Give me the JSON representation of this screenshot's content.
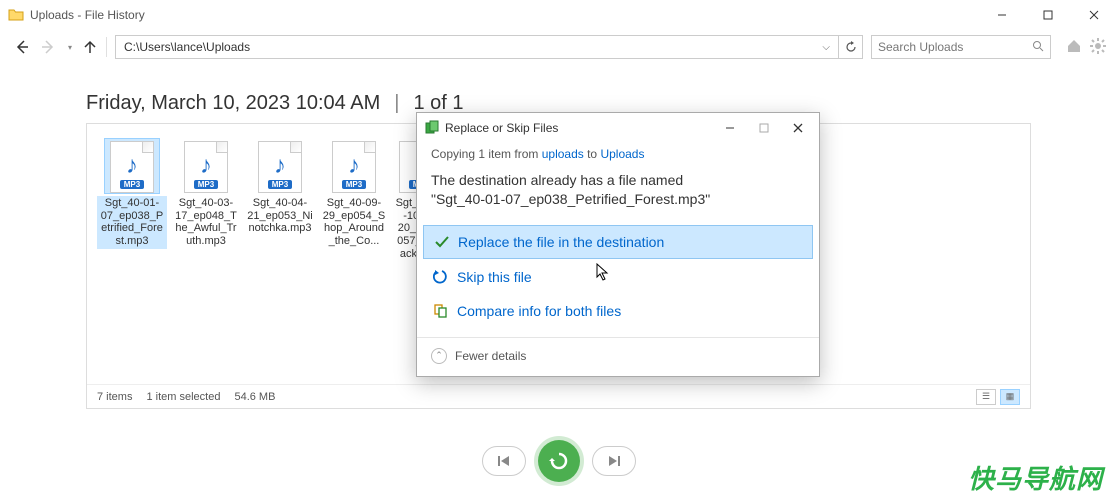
{
  "window": {
    "title": "Uploads - File History"
  },
  "nav": {
    "address_path": "C:\\Users\\lance\\Uploads",
    "search_placeholder": "Search Uploads"
  },
  "header": {
    "date_text": "Friday, March 10, 2023 10:04 AM",
    "separator": "|",
    "page_text": "1 of 1"
  },
  "files": [
    {
      "name": "Sgt_40-01-07_ep038_Petrified_Forest.mp3",
      "selected": true
    },
    {
      "name": "Sgt_40-03-17_ep048_The_Awful_Truth.mp3",
      "selected": false
    },
    {
      "name": "Sgt_40-04-21_ep053_Ninotchka.mp3",
      "selected": false
    },
    {
      "name": "Sgt_40-09-29_ep054_Shop_Around_the_Co...",
      "selected": false
    },
    {
      "name": "Sgt_40-10-20_ep057_Back...",
      "selected": false
    }
  ],
  "status": {
    "count_text": "7 items",
    "selection_text": "1 item selected",
    "size_text": "54.6 MB"
  },
  "dialog": {
    "title": "Replace or Skip Files",
    "copy_prefix": "Copying 1 item from ",
    "copy_from": "uploads",
    "copy_to_word": " to ",
    "copy_to": "Uploads",
    "destination_line_1": "The destination already has a file named",
    "destination_line_2": "\"Sgt_40-01-07_ep038_Petrified_Forest.mp3\"",
    "action_replace": "Replace the file in the destination",
    "action_skip": "Skip this file",
    "action_compare": "Compare info for both files",
    "fewer_details": "Fewer details"
  },
  "watermark_text": "快马导航网"
}
